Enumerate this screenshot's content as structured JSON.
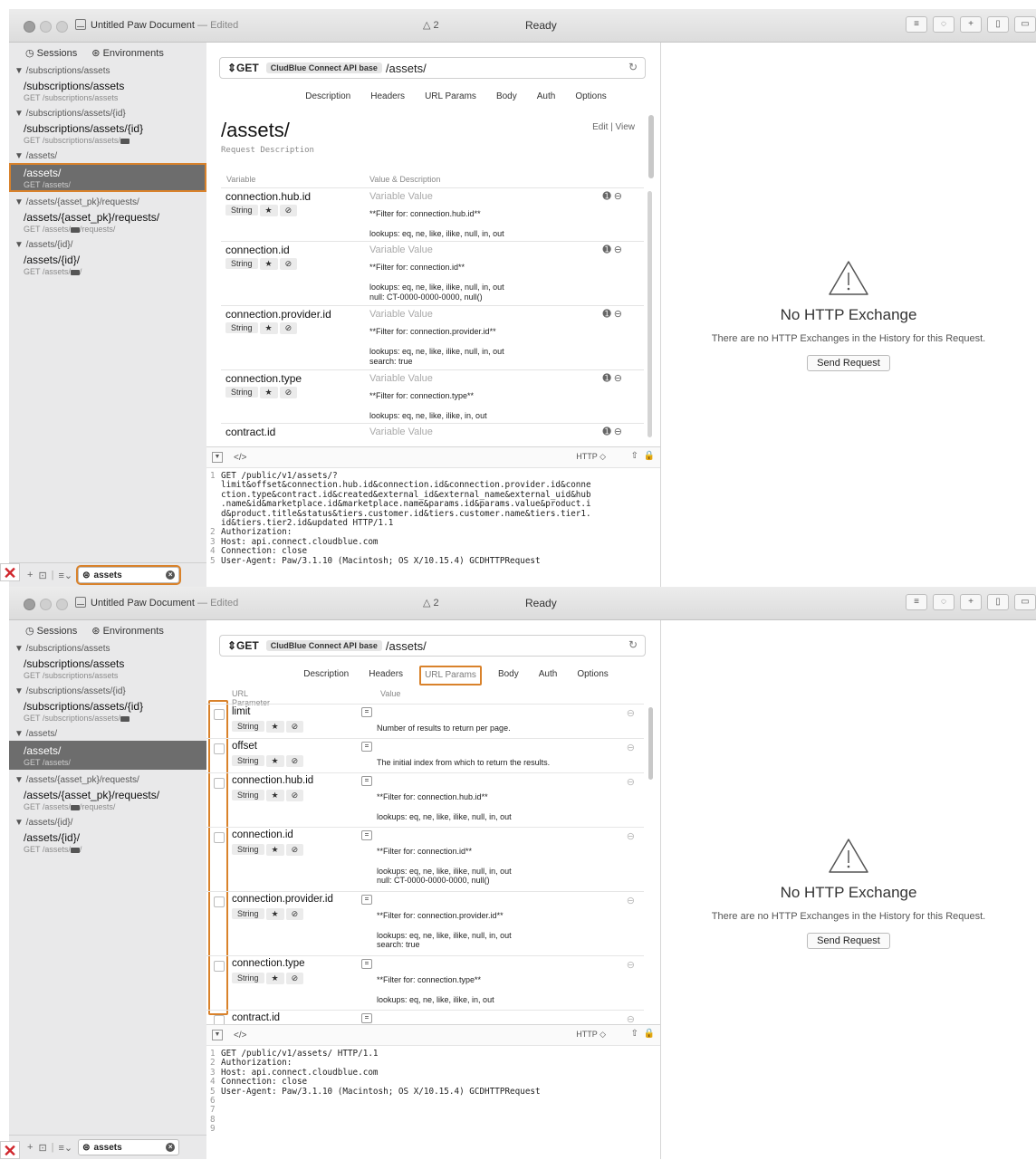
{
  "window": {
    "doc_title": "Untitled Paw Document",
    "doc_state": "— Edited",
    "warnings": "△ 2",
    "status": "Ready"
  },
  "sidebar": {
    "sessions_label": "Sessions",
    "environments_label": "Environments",
    "groups": [
      {
        "header": "▼ /subscriptions/assets",
        "path": "/subscriptions/assets",
        "method": "GET /subscriptions/assets"
      },
      {
        "header": "▼ /subscriptions/assets/{id}",
        "path": "/subscriptions/assets/{id}",
        "method": "GET /subscriptions/assets/"
      },
      {
        "header": "▼ /assets/",
        "path": "/assets/",
        "method": "GET /assets/"
      },
      {
        "header": "▼ /assets/{asset_pk}/requests/",
        "path": "/assets/{asset_pk}/requests/",
        "method": "GET /assets/",
        "method_suffix": "/requests/"
      },
      {
        "header": "▼ /assets/{id}/",
        "path": "/assets/{id}/",
        "method": "GET /assets/",
        "method_suffix": "/"
      }
    ],
    "search_value": "assets"
  },
  "request": {
    "method": "⇕GET",
    "base_chip": "CludBlue Connect API base",
    "path": "/assets/",
    "tabs": [
      "Description",
      "Headers",
      "URL Params",
      "Body",
      "Auth",
      "Options"
    ]
  },
  "description": {
    "title": "/assets/",
    "edit_view": "Edit  |  View",
    "request_description": "Request Description",
    "col_variable": "Variable",
    "col_value": "Value & Description",
    "type_label": "String",
    "variable_placeholder": "Variable Value",
    "variables": [
      {
        "name": "connection.hub.id",
        "filter": "**Filter for: connection.hub.id**",
        "lookups": [
          "lookups: eq, ne, like, ilike, null, in, out"
        ]
      },
      {
        "name": "connection.id",
        "filter": "**Filter for: connection.id**",
        "lookups": [
          "lookups: eq, ne, like, ilike, null, in, out",
          "null: CT-0000-0000-0000, null()"
        ]
      },
      {
        "name": "connection.provider.id",
        "filter": "**Filter for: connection.provider.id**",
        "lookups": [
          "lookups: eq, ne, like, ilike, null, in, out",
          "search: true"
        ]
      },
      {
        "name": "connection.type",
        "filter": "**Filter for: connection.type**",
        "lookups": [
          "lookups: eq, ne, like, ilike, in, out"
        ]
      },
      {
        "name": "contract.id"
      }
    ]
  },
  "url_params": {
    "col_param": "URL Parameter",
    "col_value": "Value",
    "params": [
      {
        "name": "limit",
        "d1": "Number of results to return per page."
      },
      {
        "name": "offset",
        "d1": "The initial index from which to return the results."
      },
      {
        "name": "connection.hub.id",
        "d1": "**Filter for: connection.hub.id**",
        "d2": [
          "lookups: eq, ne, like, ilike, null, in, out"
        ]
      },
      {
        "name": "connection.id",
        "d1": "**Filter for: connection.id**",
        "d2": [
          "lookups: eq, ne, like, ilike, null, in, out",
          "null: CT-0000-0000-0000, null()"
        ]
      },
      {
        "name": "connection.provider.id",
        "d1": "**Filter for: connection.provider.id**",
        "d2": [
          "lookups: eq, ne, like, ilike, null, in, out",
          "search: true"
        ]
      },
      {
        "name": "connection.type",
        "d1": "**Filter for: connection.type**",
        "d2": [
          "lookups: eq, ne, like, ilike, in, out"
        ]
      },
      {
        "name": "contract.id"
      }
    ]
  },
  "code_bar": {
    "code_icon": "</>",
    "format": "HTTP ◇"
  },
  "code1": [
    "GET /public/v1/assets/?",
    "limit&offset&connection.hub.id&connection.id&connection.provider.id&conne",
    "ction.type&contract.id&created&external_id&external_name&external_uid&hub",
    ".name&id&marketplace.id&marketplace.name&params.id&params.value&product.i",
    "d&product.title&status&tiers.customer.id&tiers.customer.name&tiers.tier1.",
    "id&tiers.tier2.id&updated HTTP/1.1",
    "Authorization:",
    "Host: api.connect.cloudblue.com",
    "Connection: close",
    "User-Agent: Paw/3.1.10 (Macintosh; OS X/10.15.4) GCDHTTPRequest"
  ],
  "code1_numbers": [
    "1",
    "",
    "",
    "",
    "",
    "",
    "2",
    "3",
    "4",
    "5"
  ],
  "code2": [
    "GET /public/v1/assets/ HTTP/1.1",
    "Authorization:",
    "Host: api.connect.cloudblue.com",
    "Connection: close",
    "User-Agent: Paw/3.1.10 (Macintosh; OS X/10.15.4) GCDHTTPRequest",
    "",
    "",
    "",
    ""
  ],
  "code2_numbers": [
    "1",
    "2",
    "3",
    "4",
    "5",
    "6",
    "7",
    "8",
    "9"
  ],
  "history": {
    "title": "No HTTP Exchange",
    "subtitle": "There are no HTTP Exchanges in the History for this Request.",
    "send_button": "Send Request"
  },
  "colors": {
    "highlight": "#d9822b",
    "selection": "#6d6d6d",
    "error_mark": "#d0262c"
  }
}
